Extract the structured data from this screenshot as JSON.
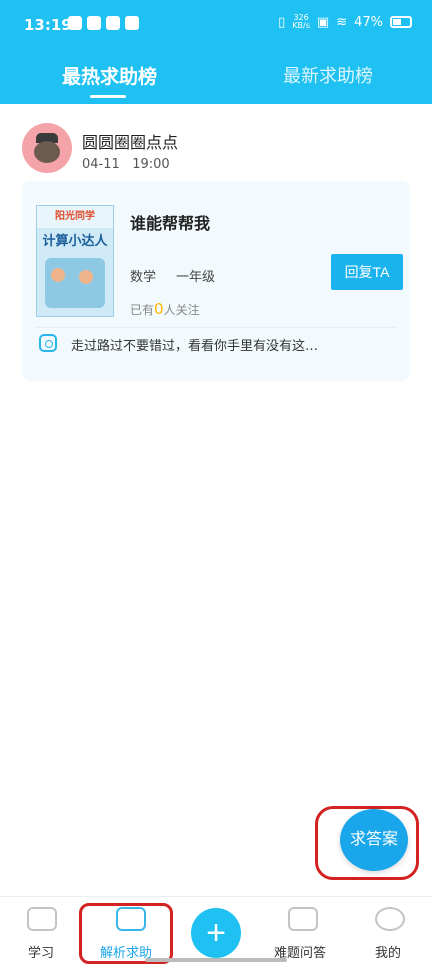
{
  "status_bar": {
    "time": "13:19",
    "net_speed_value": "326",
    "net_speed_unit": "KB/s",
    "battery": "47%"
  },
  "tabs": [
    {
      "label": "最热求助榜"
    },
    {
      "label": "最新求助榜"
    }
  ],
  "post": {
    "username": "圆圆圈圈点点",
    "date": "04-11",
    "time": "19:00",
    "book_cover_brand": "阳光同学",
    "book_cover_title": "计算小达人",
    "question_title": "谁能帮帮我",
    "subject": "数学",
    "grade": "一年级",
    "reply_label": "回复TA",
    "followers_prefix": "已有",
    "followers_count": "0",
    "followers_suffix": "人关注",
    "message": "走过路过不要错过，看看你手里有没有这…"
  },
  "fab": {
    "label": "求答案"
  },
  "bottom_nav": [
    {
      "label": "学习",
      "icon": "book-icon"
    },
    {
      "label": "解析求助",
      "icon": "chat-icon"
    },
    {
      "label": "",
      "icon": "plus-icon"
    },
    {
      "label": "难题问答",
      "icon": "question-icon"
    },
    {
      "label": "我的",
      "icon": "person-icon"
    }
  ],
  "colors": {
    "brand": "#1ec1f2",
    "button": "#1bb3ee",
    "highlight_outline": "#d32222"
  }
}
